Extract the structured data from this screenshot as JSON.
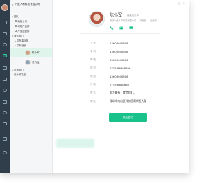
{
  "app": {
    "company": "六度人和科技有限公司",
    "colors": {
      "rail": "#2f3e4a",
      "accent": "#19c28a",
      "selected_bg": "#dff5ec"
    }
  },
  "tree": {
    "items": [
      {
        "label": "团队"
      },
      {
        "label": "高级公司"
      },
      {
        "label": "研发产品部"
      },
      {
        "label": "产品运营部"
      },
      {
        "label": "商务部门"
      },
      {
        "label": "华东事业部"
      },
      {
        "label": "华东营销"
      }
    ],
    "people": [
      {
        "name": "陈小军",
        "selected": true
      },
      {
        "name": "江飞龙",
        "selected": false
      }
    ],
    "footer_items": [
      {
        "label": "市场部门"
      },
      {
        "label": "设计研发组"
      }
    ]
  },
  "profile": {
    "name": "陈小军",
    "title": "高级设计师",
    "department": "深圳六度人和科技有限公司 — 产品部 — 运营部"
  },
  "actions": [
    {
      "icon": "phone-icon"
    },
    {
      "icon": "mail-icon"
    },
    {
      "icon": "message-icon"
    }
  ],
  "fields": [
    {
      "label": "工号",
      "value": "13603040506"
    },
    {
      "label": "手机",
      "value": "13603040506"
    },
    {
      "label": "邮箱",
      "value": "13603040506"
    },
    {
      "label": "座机",
      "value": "0755-86868686"
    },
    {
      "label": "电话",
      "value": "13603040506"
    },
    {
      "label": "传真",
      "value": "0755-6868686"
    },
    {
      "label": "签名",
      "value": "努力最棒，就是我们。"
    },
    {
      "label": "地址",
      "value": "深圳市南山区科技园高新区大厦"
    }
  ],
  "buttons": {
    "send": "发起会话"
  }
}
